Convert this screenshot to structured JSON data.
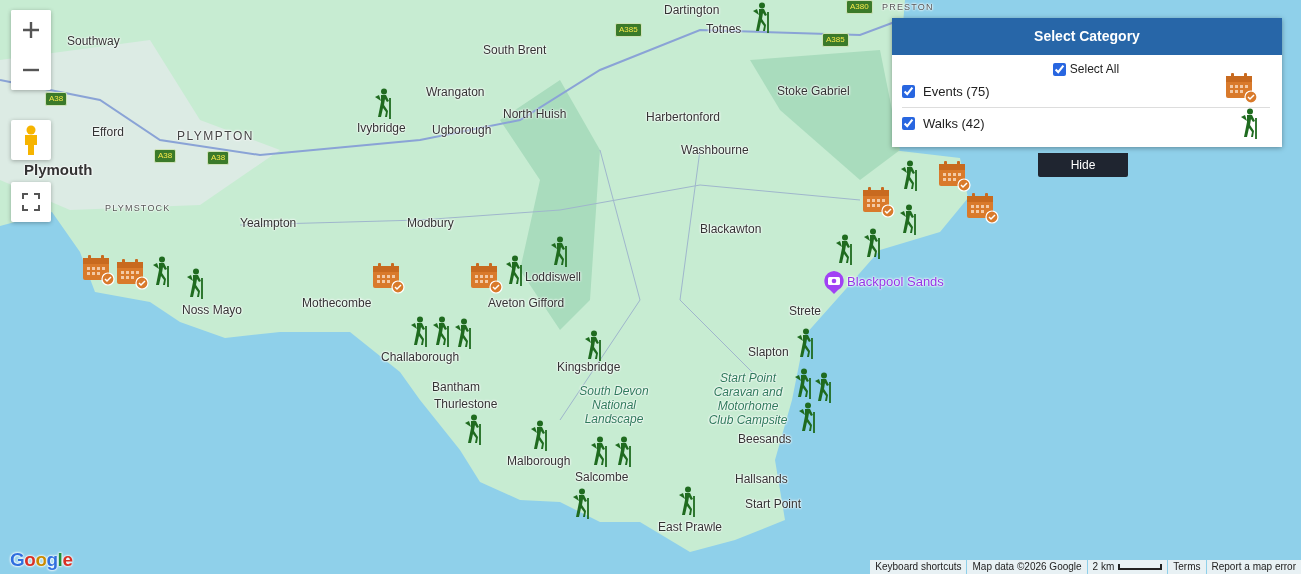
{
  "map": {
    "labels": [
      {
        "text": "Dartington",
        "kind": "town"
      },
      {
        "text": "A380",
        "kind": "road"
      },
      {
        "text": "PRESTON",
        "kind": "district-small"
      },
      {
        "text": "A385",
        "kind": "road"
      },
      {
        "text": "Totnes",
        "kind": "town"
      },
      {
        "text": "Southway",
        "kind": "town"
      },
      {
        "text": "A385",
        "kind": "road"
      },
      {
        "text": "South Brent",
        "kind": "town"
      },
      {
        "text": "Wrangaton",
        "kind": "town"
      },
      {
        "text": "Stoke Gabriel",
        "kind": "town"
      },
      {
        "text": "A38",
        "kind": "road"
      },
      {
        "text": "North Huish",
        "kind": "town"
      },
      {
        "text": "Harbertonford",
        "kind": "town"
      },
      {
        "text": "Efford",
        "kind": "town"
      },
      {
        "text": "PLYMPTON",
        "kind": "district"
      },
      {
        "text": "Ivybridge",
        "kind": "town"
      },
      {
        "text": "Ugborough",
        "kind": "town"
      },
      {
        "text": "A38",
        "kind": "road"
      },
      {
        "text": "A38",
        "kind": "road"
      },
      {
        "text": "Washbourne",
        "kind": "town"
      },
      {
        "text": "Plymouth",
        "kind": "city"
      },
      {
        "text": "PLYMSTOCK",
        "kind": "district-small"
      },
      {
        "text": "Yealmpton",
        "kind": "town"
      },
      {
        "text": "Modbury",
        "kind": "town"
      },
      {
        "text": "Blackawton",
        "kind": "town"
      },
      {
        "text": "Loddiswell",
        "kind": "town"
      },
      {
        "text": "Blackpool Sands",
        "kind": "poi"
      },
      {
        "text": "Noss Mayo",
        "kind": "town"
      },
      {
        "text": "Mothecombe",
        "kind": "town"
      },
      {
        "text": "Aveton Gifford",
        "kind": "town"
      },
      {
        "text": "Strete",
        "kind": "town"
      },
      {
        "text": "Challaborough",
        "kind": "town"
      },
      {
        "text": "Slapton",
        "kind": "town"
      },
      {
        "text": "Kingsbridge",
        "kind": "town"
      },
      {
        "text": "Bantham",
        "kind": "town"
      },
      {
        "text": "Thurlestone",
        "kind": "town"
      },
      {
        "text": "South Devon National Landscape",
        "kind": "park"
      },
      {
        "text": "Start Point Caravan and Motorhome Club Campsite",
        "kind": "park"
      },
      {
        "text": "Beesands",
        "kind": "town"
      },
      {
        "text": "Malborough",
        "kind": "town"
      },
      {
        "text": "Salcombe",
        "kind": "town"
      },
      {
        "text": "Hallsands",
        "kind": "town"
      },
      {
        "text": "Start Point",
        "kind": "town"
      },
      {
        "text": "East Prawle",
        "kind": "town"
      }
    ],
    "markers": [
      {
        "kind": "walk"
      },
      {
        "kind": "walk"
      },
      {
        "kind": "walk"
      },
      {
        "kind": "walk"
      },
      {
        "kind": "walk"
      },
      {
        "kind": "walk"
      },
      {
        "kind": "walk"
      },
      {
        "kind": "walk"
      },
      {
        "kind": "walk"
      },
      {
        "kind": "walk"
      },
      {
        "kind": "walk"
      },
      {
        "kind": "walk"
      },
      {
        "kind": "walk"
      },
      {
        "kind": "walk"
      },
      {
        "kind": "walk"
      },
      {
        "kind": "walk"
      },
      {
        "kind": "walk"
      },
      {
        "kind": "walk"
      },
      {
        "kind": "walk"
      },
      {
        "kind": "walk"
      },
      {
        "kind": "walk"
      },
      {
        "kind": "walk"
      },
      {
        "kind": "walk"
      },
      {
        "kind": "walk"
      },
      {
        "kind": "event"
      },
      {
        "kind": "event"
      },
      {
        "kind": "event"
      },
      {
        "kind": "event"
      },
      {
        "kind": "event"
      },
      {
        "kind": "event"
      },
      {
        "kind": "event"
      }
    ]
  },
  "legend": {
    "title": "Select Category",
    "select_all": {
      "label": "Select All",
      "checked": true
    },
    "categories": [
      {
        "label": "Events (75)",
        "kind": "event",
        "checked": true
      },
      {
        "label": "Walks (42)",
        "kind": "walk",
        "checked": true
      }
    ],
    "hide_button": "Hide"
  },
  "logo": "Google",
  "footer": {
    "keyboard_shortcuts": "Keyboard shortcuts",
    "map_data": "Map data ©2026 Google",
    "scale": "2 km",
    "terms": "Terms",
    "report": "Report a map error"
  }
}
